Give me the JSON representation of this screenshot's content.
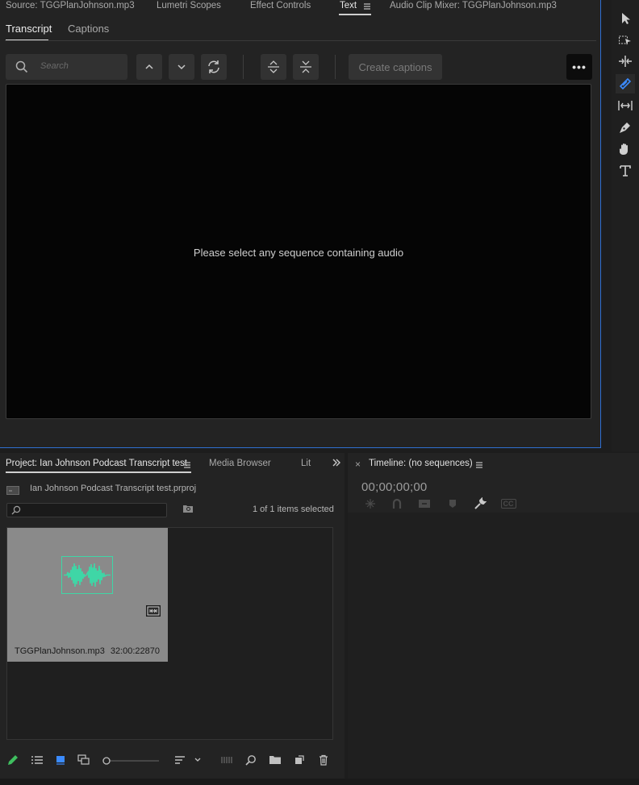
{
  "top_tabs": [
    {
      "label": "Source: TGGPlanJohnson.mp3"
    },
    {
      "label": "Lumetri Scopes"
    },
    {
      "label": "Effect Controls"
    },
    {
      "label": "Text"
    },
    {
      "label": "Audio Clip Mixer: TGGPlanJohnson.mp3"
    }
  ],
  "sub_tabs": [
    {
      "label": "Transcript"
    },
    {
      "label": "Captions"
    }
  ],
  "search": {
    "placeholder": "Search"
  },
  "create_captions_label": "Create captions",
  "more_label": "•••",
  "transcript_message": "Please select any sequence containing audio",
  "tools": [
    "selection-tool-icon",
    "track-select-tool-icon",
    "ripple-edit-tool-icon",
    "razor-tool-icon",
    "slip-tool-icon",
    "pen-tool-icon",
    "hand-tool-icon",
    "type-tool-icon"
  ],
  "project": {
    "tabs": [
      {
        "label": "Project: Ian Johnson Podcast Transcript test"
      },
      {
        "label": "Media Browser"
      },
      {
        "label": "Lit"
      }
    ],
    "file_name": "Ian Johnson Podcast Transcript test.prproj",
    "selection_count": "1 of 1 items selected",
    "clip": {
      "name": "TGGPlanJohnson.mp3",
      "duration": "32:00:22870"
    }
  },
  "timeline": {
    "close_label": "×",
    "title": "Timeline: (no sequences)",
    "timecode": "00;00;00;00",
    "cc_label": "CC"
  },
  "colors": {
    "accent": "#2f6fd1",
    "waveform": "#3fd6a6",
    "pencil": "#3fbf5f"
  }
}
